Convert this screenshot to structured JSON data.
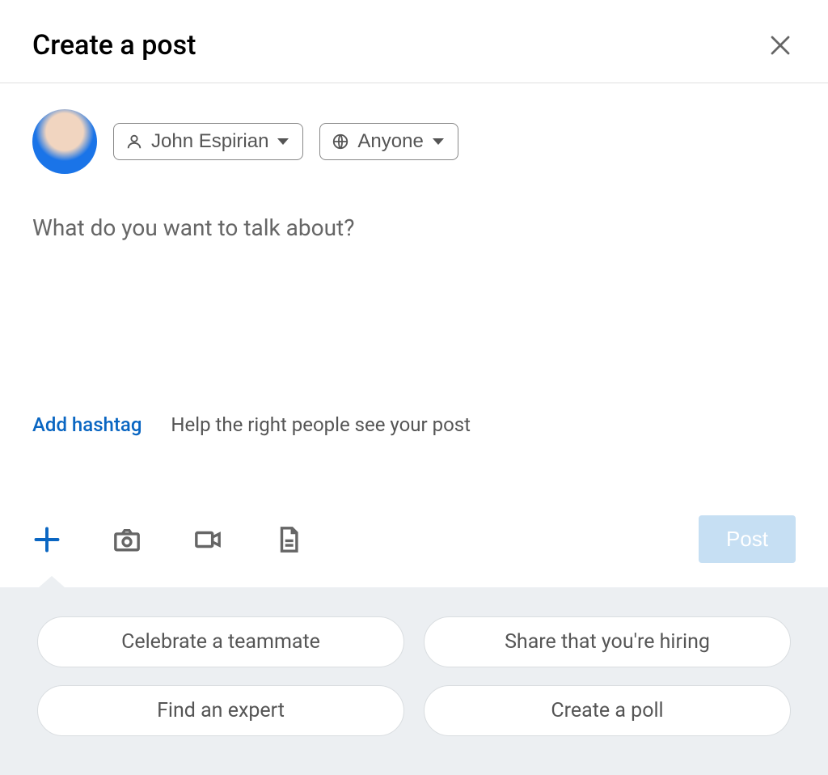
{
  "header": {
    "title": "Create a post"
  },
  "author": {
    "name": "John Espirian",
    "audience": "Anyone"
  },
  "compose": {
    "placeholder": "What do you want to talk about?",
    "value": ""
  },
  "hashtag": {
    "add_label": "Add hashtag",
    "hint": "Help the right people see your post"
  },
  "actions": {
    "post_label": "Post"
  },
  "suggestions": [
    "Celebrate a teammate",
    "Share that you're hiring",
    "Find an expert",
    "Create a poll"
  ]
}
